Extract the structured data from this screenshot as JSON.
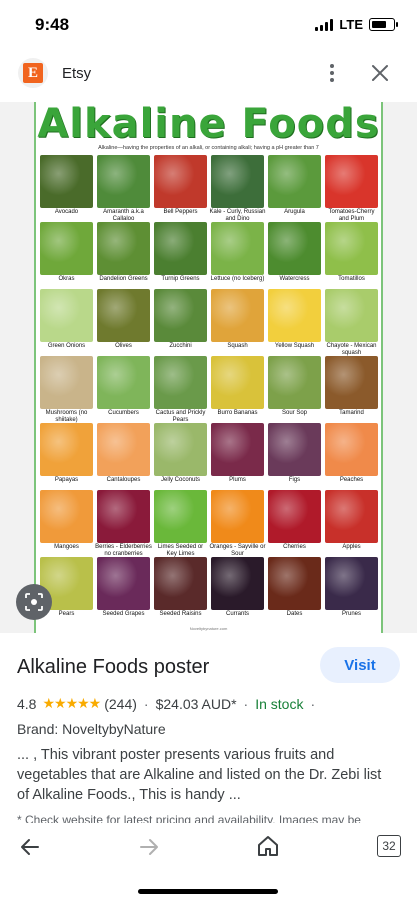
{
  "status_bar": {
    "time": "9:48",
    "network": "LTE",
    "battery_level": 0.75
  },
  "app_bar": {
    "site_name": "Etsy",
    "logo_letter": "E",
    "menu_icon": "more-vert-icon",
    "close_icon": "close-icon"
  },
  "poster": {
    "title": "Alkaline Foods",
    "subtitle": "Alkaline—having the properties of an alkali, or containing alkali; having a pH greater than 7",
    "credit": "Noveltybynature.com",
    "accent_color": "#3aa53a",
    "foods": [
      {
        "name": "Avocado",
        "color": "#4a6b2a"
      },
      {
        "name": "Amaranth a.k.a Callaloo",
        "color": "#4f8b3a"
      },
      {
        "name": "Bell Peppers",
        "color": "#c0392b"
      },
      {
        "name": "Kale - Curly, Russian and Dino",
        "color": "#3d6e3a"
      },
      {
        "name": "Arugula",
        "color": "#5b9a3c"
      },
      {
        "name": "Tomatoes-Cherry and Plum",
        "color": "#d9352b"
      },
      {
        "name": "Okras",
        "color": "#6fa83a"
      },
      {
        "name": "Dandelion Greens",
        "color": "#5e8f34"
      },
      {
        "name": "Turnip Greens",
        "color": "#4b7f30"
      },
      {
        "name": "Lettuce (no Iceberg)",
        "color": "#7bb348"
      },
      {
        "name": "Watercress",
        "color": "#4d8c2f"
      },
      {
        "name": "Tomatillos",
        "color": "#8fbf4a"
      },
      {
        "name": "Green Onions",
        "color": "#b9d88a"
      },
      {
        "name": "Olives",
        "color": "#6f7a2e"
      },
      {
        "name": "Zucchini",
        "color": "#5a8a3a"
      },
      {
        "name": "Squash",
        "color": "#e0a43a"
      },
      {
        "name": "Yellow Squash",
        "color": "#f2cf3d"
      },
      {
        "name": "Chayote - Mexican squash",
        "color": "#a9cc6b"
      },
      {
        "name": "Mushrooms (no shiitake)",
        "color": "#c9b48a"
      },
      {
        "name": "Cucumbers",
        "color": "#7fb55a"
      },
      {
        "name": "Cactus and Prickly Pears",
        "color": "#6a9a4a"
      },
      {
        "name": "Burro Bananas",
        "color": "#d9c23a"
      },
      {
        "name": "Sour Sop",
        "color": "#7da14a"
      },
      {
        "name": "Tamarind",
        "color": "#8b5a2b"
      },
      {
        "name": "Papayas",
        "color": "#f0a23a"
      },
      {
        "name": "Cantaloupes",
        "color": "#f2a15a"
      },
      {
        "name": "Jelly Coconuts",
        "color": "#9ab86a"
      },
      {
        "name": "Plums",
        "color": "#7a2a4a"
      },
      {
        "name": "Figs",
        "color": "#6a3a5a"
      },
      {
        "name": "Peaches",
        "color": "#f08a4a"
      },
      {
        "name": "Mangoes",
        "color": "#f09a3a"
      },
      {
        "name": "Berries - Elderberries no cranberries",
        "color": "#8a1a3a"
      },
      {
        "name": "Limes Seeded or Key Limes",
        "color": "#6ab83a"
      },
      {
        "name": "Oranges - Sayville or Sour",
        "color": "#f08a1a"
      },
      {
        "name": "Cherries",
        "color": "#b01a2a"
      },
      {
        "name": "Apples",
        "color": "#c8302a"
      },
      {
        "name": "Pears",
        "color": "#b9c04a"
      },
      {
        "name": "Seeded Grapes",
        "color": "#6a2a5a"
      },
      {
        "name": "Seeded Raisins",
        "color": "#5a2a2a"
      },
      {
        "name": "Currants",
        "color": "#2a1a2a"
      },
      {
        "name": "Dates",
        "color": "#6a2a1a"
      },
      {
        "name": "Prunes",
        "color": "#3a2a4a"
      }
    ]
  },
  "details": {
    "product_title": "Alkaline Foods poster",
    "visit_label": "Visit",
    "rating": "4.8",
    "stars": "★★★★★",
    "review_count": "(244)",
    "price": "$24.03 AUD*",
    "stock_status": "In stock",
    "brand": "Brand: NoveltybyNature",
    "description": "... , This vibrant poster presents various fruits and vegetables that are Alkaline and listed on the Dr. Zebi list of Alkaline Foods., This is handy ...",
    "fineprint": "* Check website for latest pricing and availability. Images may be"
  },
  "bottom_nav": {
    "tab_count": "32"
  }
}
